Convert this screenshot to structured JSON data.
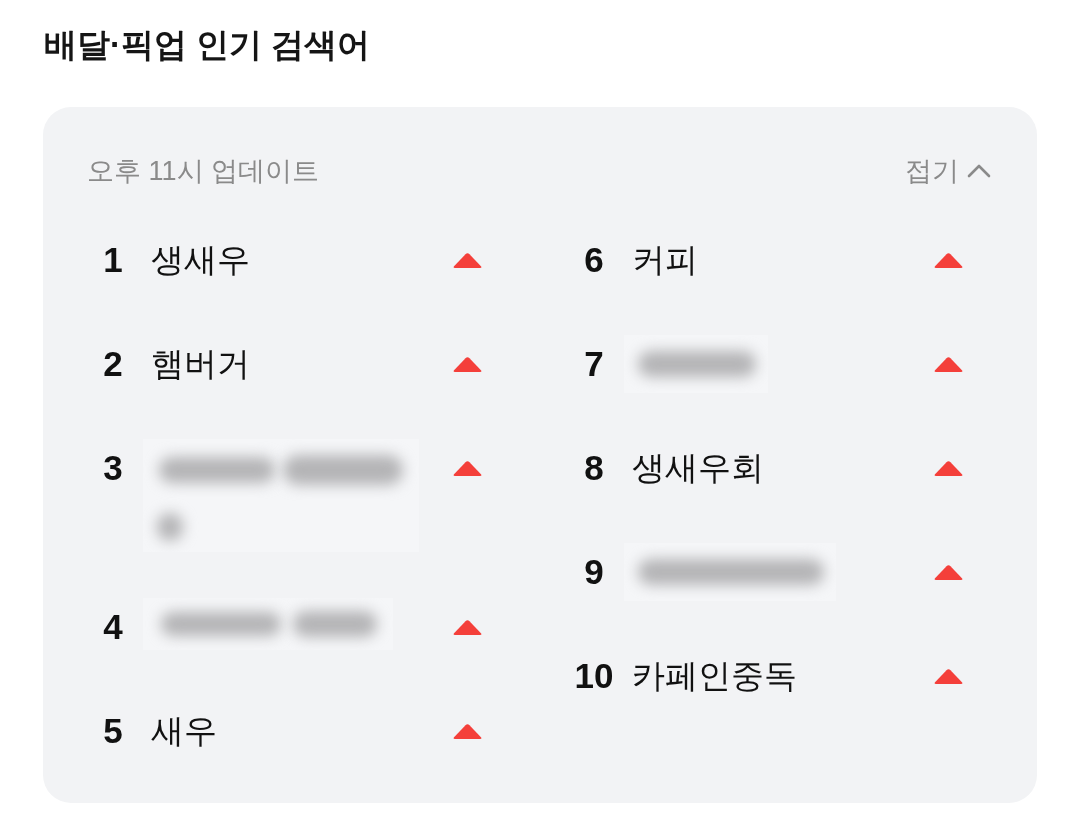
{
  "title": "배달·픽업 인기 검색어",
  "panel": {
    "updated": "오후 11시 업데이트",
    "collapse_button": {
      "label": "접기",
      "expanded": true
    },
    "columns": [
      {
        "items": [
          {
            "rank": "1",
            "kind": "term",
            "term": "생새우",
            "rising": true
          },
          {
            "rank": "2",
            "kind": "term",
            "term": "햄버거",
            "rising": true
          },
          {
            "rank": "3",
            "kind": "blur-wrap",
            "rising": true
          },
          {
            "rank": "4",
            "kind": "blur-long",
            "rising": true
          },
          {
            "rank": "5",
            "kind": "term",
            "term": "새우",
            "rising": true
          }
        ]
      },
      {
        "items": [
          {
            "rank": "6",
            "kind": "term",
            "term": "커피",
            "rising": true
          },
          {
            "rank": "7",
            "kind": "blur-short",
            "rising": true
          },
          {
            "rank": "8",
            "kind": "term",
            "term": "생새우회",
            "rising": true
          },
          {
            "rank": "9",
            "kind": "blur-medium",
            "rising": true
          },
          {
            "rank": "10",
            "kind": "term",
            "term": "카페인중독",
            "rising": true
          }
        ]
      }
    ]
  }
}
